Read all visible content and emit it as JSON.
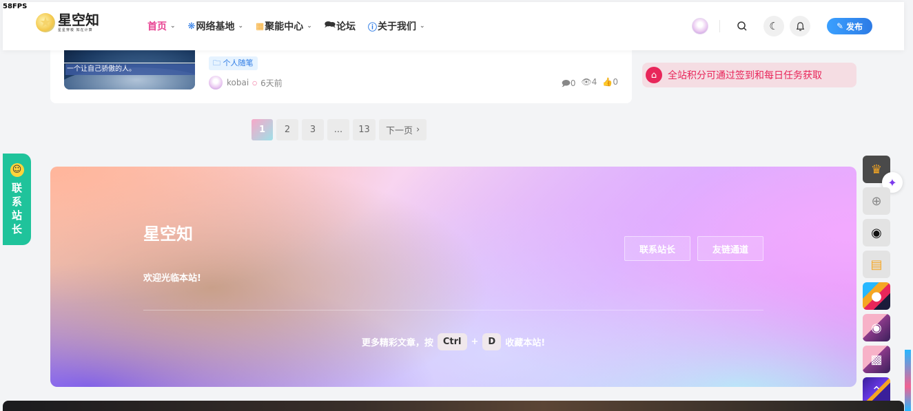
{
  "fps": "58FPS",
  "logo": {
    "title": "星空知",
    "sub": "星星穿梭    知在计算"
  },
  "nav": {
    "items": [
      {
        "label": "首页",
        "icon": "",
        "chevron": true
      },
      {
        "label": "网络基地",
        "icon": "network-icon",
        "chevron": true
      },
      {
        "label": "聚能中心",
        "icon": "grid-icon",
        "chevron": true
      },
      {
        "label": "论坛",
        "icon": "chat-icon",
        "chevron": false
      },
      {
        "label": "关于我们",
        "icon": "info-icon",
        "chevron": true
      }
    ],
    "publish_label": "发布"
  },
  "post": {
    "thumb_caption": "一个让自己骄傲的人。",
    "tag": "个人随笔",
    "author": "kobai",
    "time": "6天前",
    "comments": "0",
    "views": "4",
    "likes": "0"
  },
  "notice": {
    "text": "全站积分可通过签到和每日任务获取"
  },
  "pagination": {
    "pages": [
      "1",
      "2",
      "3",
      "...",
      "13"
    ],
    "next_label": "下一页"
  },
  "contact_tab": {
    "label_chars": [
      "联",
      "系",
      "站",
      "长"
    ]
  },
  "hero": {
    "title": "星空知",
    "welcome": "欢迎光临本站!",
    "btn_contact": "联系站长",
    "btn_links": "友链通道",
    "bottom_pre": "更多精彩文章，按",
    "key1": "Ctrl",
    "plus": "+",
    "key2": "D",
    "bottom_post": "收藏本站!"
  },
  "colors": {
    "accent": "#e84393",
    "brand_blue": "#2d7be5",
    "notice_red": "#e8265a",
    "contact_green": "#1fc39b"
  }
}
